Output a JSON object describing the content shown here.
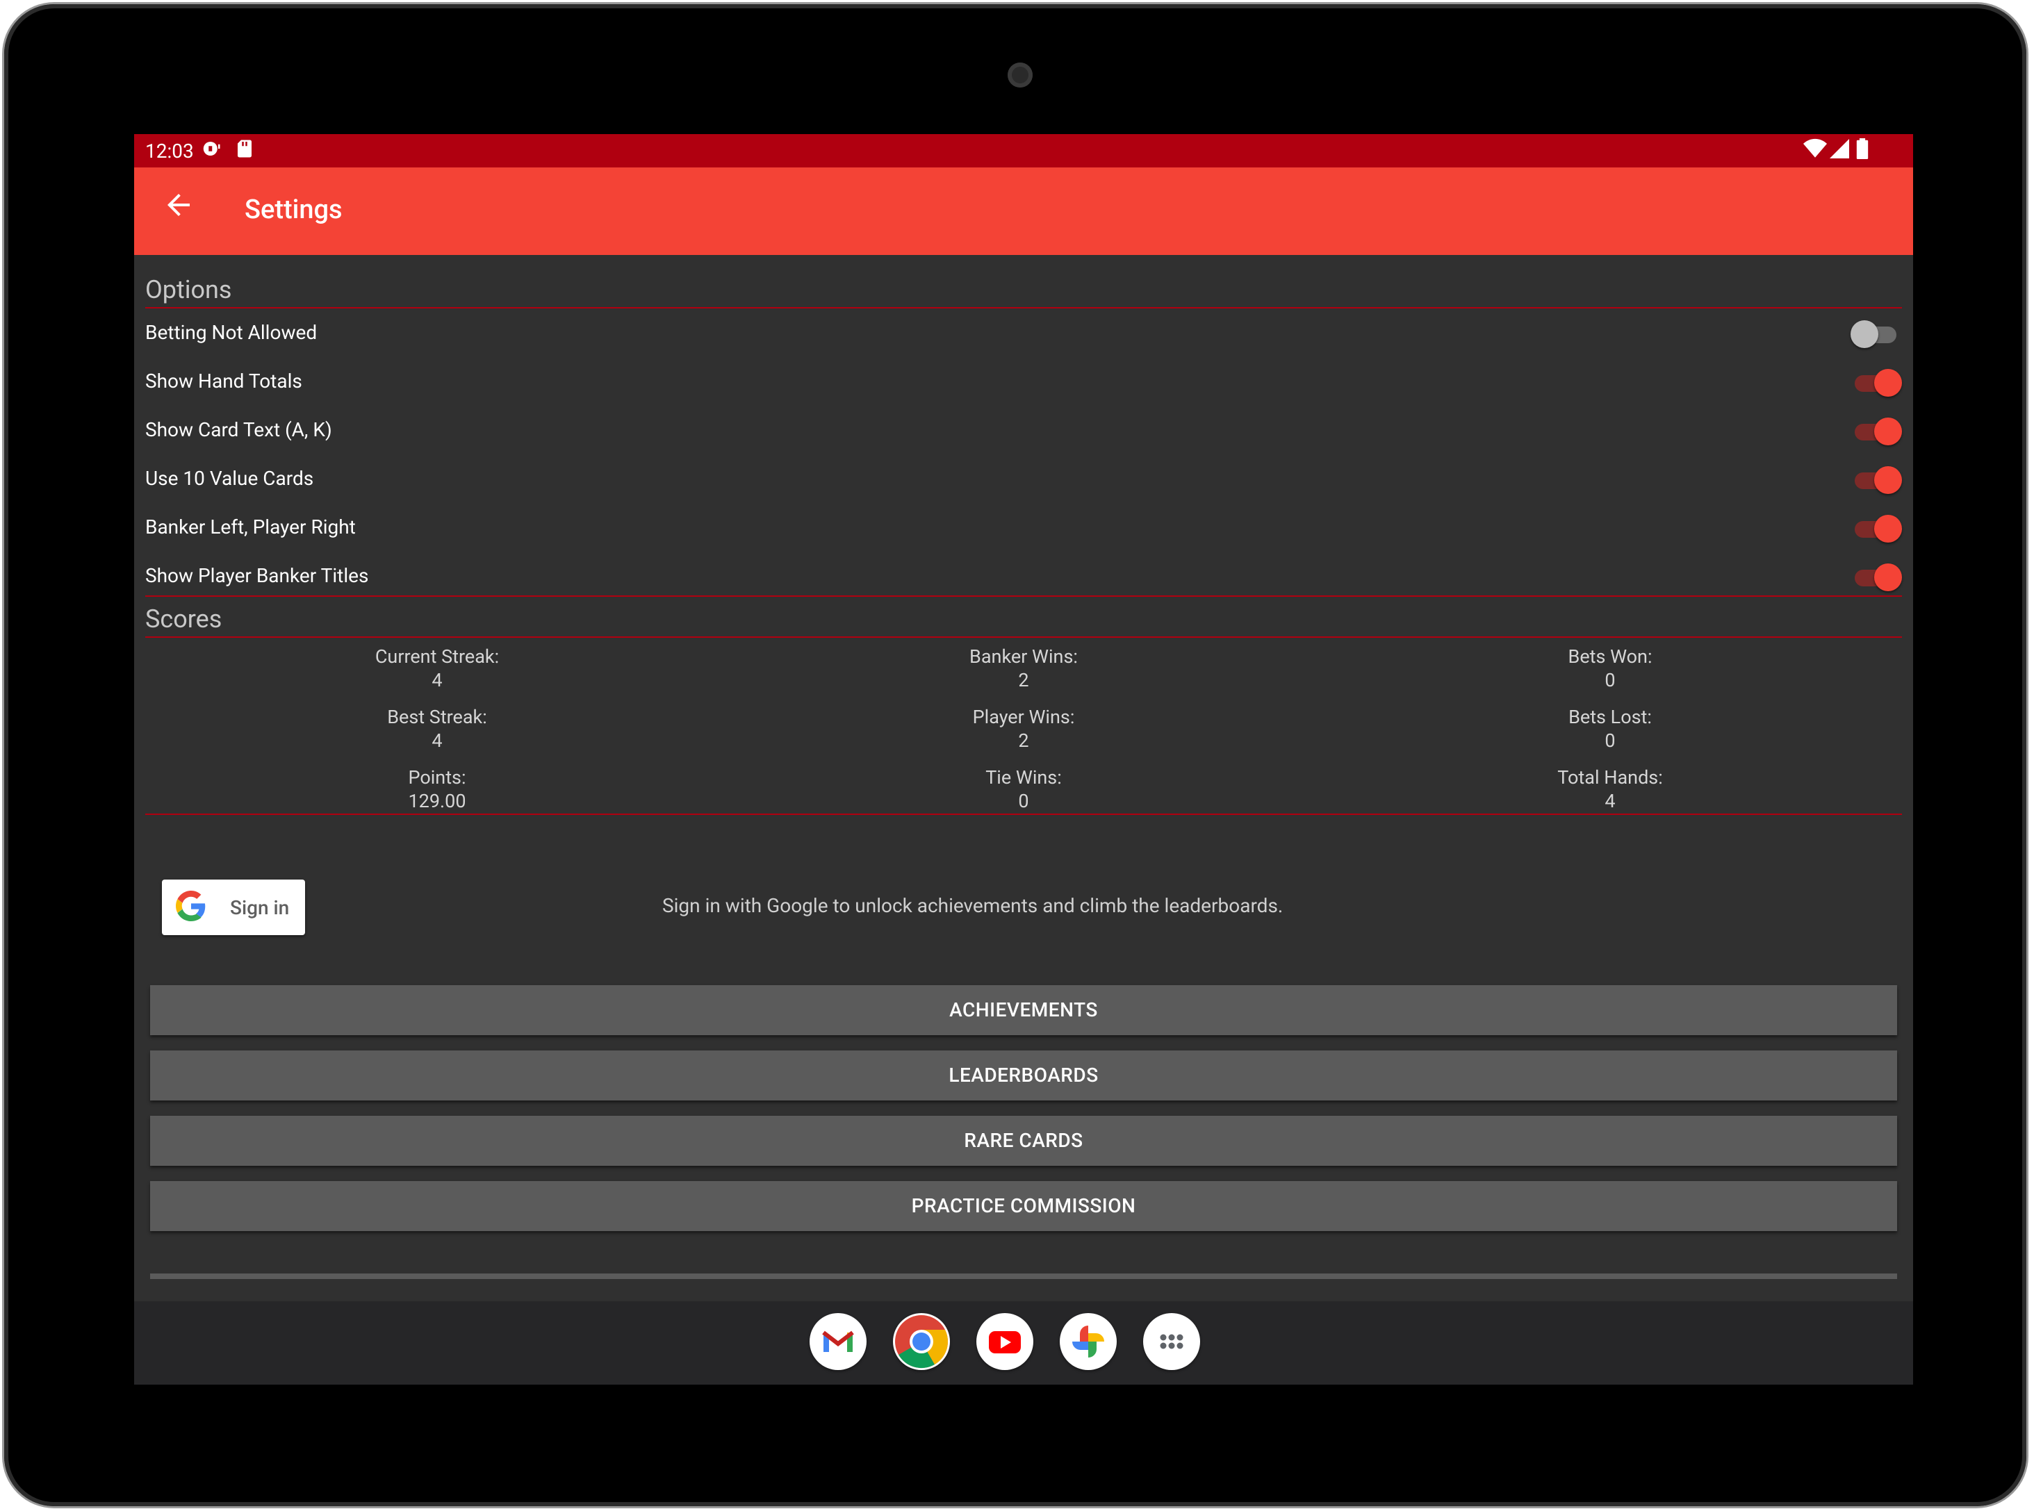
{
  "status_bar": {
    "time": "12:03"
  },
  "app_bar": {
    "title": "Settings"
  },
  "options": {
    "section_title": "Options",
    "items": [
      {
        "label": "Betting Not Allowed",
        "enabled": false
      },
      {
        "label": "Show Hand Totals",
        "enabled": true
      },
      {
        "label": "Show Card Text (A, K)",
        "enabled": true
      },
      {
        "label": "Use 10 Value Cards",
        "enabled": true
      },
      {
        "label": "Banker Left, Player Right",
        "enabled": true
      },
      {
        "label": "Show Player Banker Titles",
        "enabled": true
      }
    ]
  },
  "scores": {
    "section_title": "Scores",
    "items": [
      {
        "label": "Current Streak:",
        "value": "4"
      },
      {
        "label": "Banker Wins:",
        "value": "2"
      },
      {
        "label": "Bets Won:",
        "value": "0"
      },
      {
        "label": "Best Streak:",
        "value": "4"
      },
      {
        "label": "Player Wins:",
        "value": "2"
      },
      {
        "label": "Bets Lost:",
        "value": "0"
      },
      {
        "label": "Points:",
        "value": "129.00"
      },
      {
        "label": "Tie Wins:",
        "value": "0"
      },
      {
        "label": "Total Hands:",
        "value": "4"
      }
    ]
  },
  "signin": {
    "button_label": "Sign in",
    "message": "Sign in with Google to unlock achievements and climb the leaderboards."
  },
  "buttons": [
    "ACHIEVEMENTS",
    "LEADERBOARDS",
    "RARE CARDS",
    "PRACTICE COMMISSION"
  ],
  "dock": [
    "gmail-icon",
    "chrome-icon",
    "youtube-icon",
    "photos-icon",
    "app-drawer-icon"
  ],
  "colors": {
    "status_bar": "#b00010",
    "app_bar": "#f44336",
    "background": "#303030",
    "accent": "#f44336",
    "button": "#5b5b5b"
  }
}
